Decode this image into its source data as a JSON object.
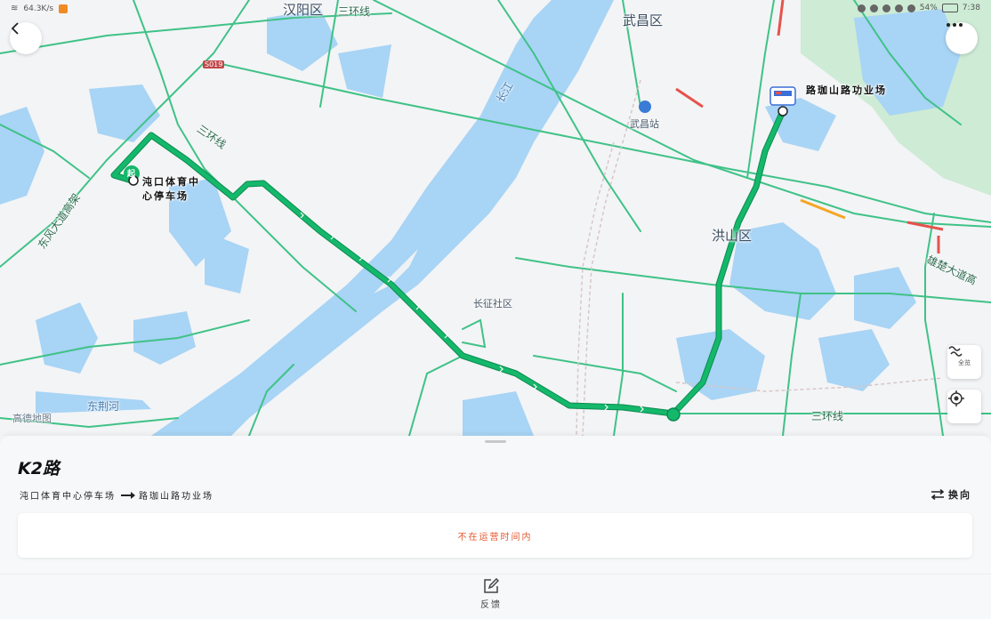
{
  "status_bar": {
    "net_speed": "64.3K/s",
    "battery": "54%",
    "time": "7:38"
  },
  "map": {
    "district_labels": [
      "汉阳区",
      "武昌区",
      "洪山区"
    ],
    "road_labels": [
      "三环线",
      "三环线",
      "三环线",
      "东风大道高架",
      "雄楚大道高",
      "长江",
      "S019"
    ],
    "place_labels": [
      "武昌站",
      "长征社区",
      "东荆河"
    ],
    "watermark": "高德地图",
    "colors": {
      "water": "#a8d4f5",
      "green": "#cdebd5",
      "road": "#3fc287",
      "route": "#14b86b",
      "congestion": "#e5534b",
      "slow": "#f5a623"
    }
  },
  "stops": {
    "start_badge": "起",
    "start_name_line1": "沌口体育中",
    "start_name_line2": "心停车场",
    "end_name": "路珈山路功业场"
  },
  "controls": {
    "back_icon": "chevron-left-icon",
    "more_icon": "more-dots-icon",
    "scenic_label": "全览",
    "locate_icon": "crosshair-icon"
  },
  "sheet": {
    "route_name": "K2路",
    "from": "沌口体育中心停车场",
    "to": "路珈山路功业场",
    "switch_label": "换向",
    "notice": "不在运营时间内",
    "feedback_label": "反馈"
  }
}
